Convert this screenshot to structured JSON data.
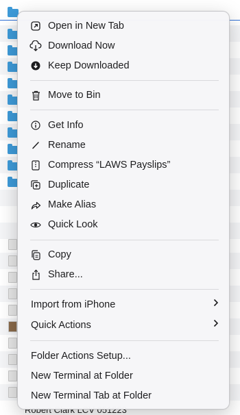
{
  "menu": {
    "items": [
      {
        "id": "open-new-tab",
        "label": "Open in New Tab",
        "icon": "open-in-new-tab-icon"
      },
      {
        "id": "download-now",
        "label": "Download Now",
        "icon": "cloud-download-icon"
      },
      {
        "id": "keep-downloaded",
        "label": "Keep Downloaded",
        "icon": "download-circle-icon"
      },
      {
        "id": "move-to-bin",
        "label": "Move to Bin",
        "icon": "trash-icon"
      },
      {
        "id": "get-info",
        "label": "Get Info",
        "icon": "info-icon"
      },
      {
        "id": "rename",
        "label": "Rename",
        "icon": "pencil-icon"
      },
      {
        "id": "compress",
        "label": "Compress “LAWS Payslips”",
        "icon": "archive-icon"
      },
      {
        "id": "duplicate",
        "label": "Duplicate",
        "icon": "duplicate-icon"
      },
      {
        "id": "make-alias",
        "label": "Make Alias",
        "icon": "alias-arrow-icon"
      },
      {
        "id": "quick-look",
        "label": "Quick Look",
        "icon": "eye-icon"
      },
      {
        "id": "copy",
        "label": "Copy",
        "icon": "copy-icon"
      },
      {
        "id": "share",
        "label": "Share...",
        "icon": "share-icon"
      },
      {
        "id": "import-iphone",
        "label": "Import from iPhone"
      },
      {
        "id": "quick-actions",
        "label": "Quick Actions"
      },
      {
        "id": "folder-actions",
        "label": "Folder Actions Setup..."
      },
      {
        "id": "new-terminal",
        "label": "New Terminal at Folder"
      },
      {
        "id": "new-terminal-tab",
        "label": "New Terminal Tab at Folder"
      }
    ]
  },
  "background": {
    "partial_row_text": "Robert Clark LCV 051223"
  },
  "colors": {
    "folder": "#3e9bd9",
    "selection": "#2f6fd6",
    "menu_bg": "#f6f6f8"
  }
}
